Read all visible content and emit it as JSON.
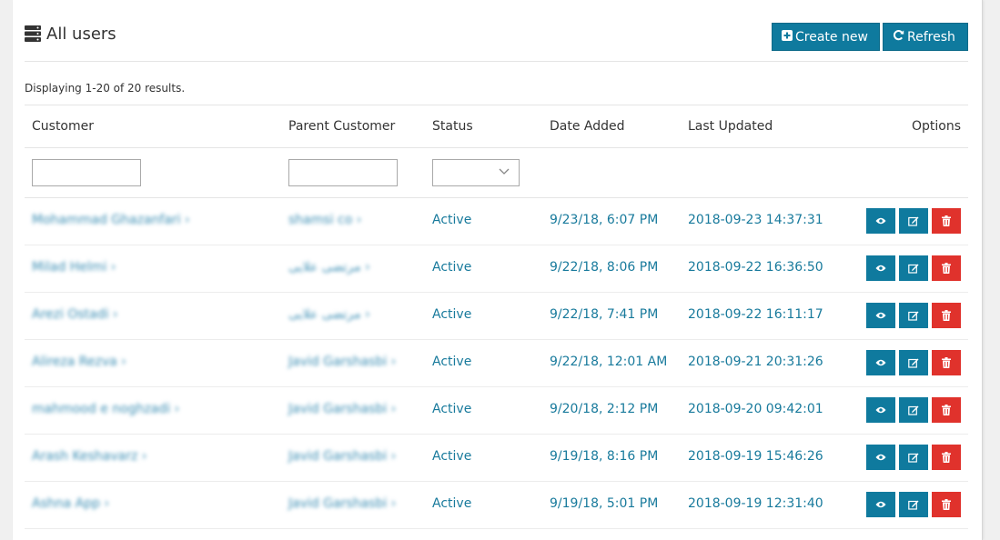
{
  "header": {
    "title": "All users",
    "create_label": "Create new",
    "refresh_label": "Refresh"
  },
  "summary": "Displaying 1-20 of 20 results.",
  "columns": [
    "Customer",
    "Parent Customer",
    "Status",
    "Date Added",
    "Last Updated",
    "Options"
  ],
  "filters": {
    "customer": "",
    "parent": "",
    "status": ""
  },
  "rows": [
    {
      "customer": "Mohammad Ghazanfari ›",
      "parent": "shamsi co ›",
      "status": "Active",
      "added": "9/23/18, 6:07 PM",
      "updated": "2018-09-23 14:37:31"
    },
    {
      "customer": "Milad Helmi ›",
      "parent": "مرتضی علایی ›",
      "status": "Active",
      "added": "9/22/18, 8:06 PM",
      "updated": "2018-09-22 16:36:50"
    },
    {
      "customer": "Arezi Ostadi ›",
      "parent": "مرتضی علایی ›",
      "status": "Active",
      "added": "9/22/18, 7:41 PM",
      "updated": "2018-09-22 16:11:17"
    },
    {
      "customer": "Alireza Rezva ›",
      "parent": "Javid Garshasbi ›",
      "status": "Active",
      "added": "9/22/18, 12:01 AM",
      "updated": "2018-09-21 20:31:26"
    },
    {
      "customer": "mahmood e noghzadi ›",
      "parent": "Javid Garshasbi ›",
      "status": "Active",
      "added": "9/20/18, 2:12 PM",
      "updated": "2018-09-20 09:42:01"
    },
    {
      "customer": "Arash Keshavarz ›",
      "parent": "Javid Garshasbi ›",
      "status": "Active",
      "added": "9/19/18, 8:16 PM",
      "updated": "2018-09-19 15:46:26"
    },
    {
      "customer": "Ashna App ›",
      "parent": "Javid Garshasbi ›",
      "status": "Active",
      "added": "9/19/18, 5:01 PM",
      "updated": "2018-09-19 12:31:40"
    }
  ],
  "colors": {
    "accent": "#0f7a9e",
    "danger": "#e0322c",
    "link": "#187a9c"
  },
  "icons": {
    "title": "server-icon",
    "create": "plus-square-icon",
    "refresh": "refresh-icon",
    "view": "eye-icon",
    "edit": "edit-icon",
    "delete": "trash-icon"
  }
}
